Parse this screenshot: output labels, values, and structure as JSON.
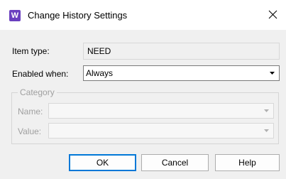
{
  "window": {
    "title": "Change History Settings",
    "app_icon_letter": "W",
    "app_icon_color": "#6a3fbf"
  },
  "form": {
    "item_type": {
      "label": "Item type:",
      "value": "NEED"
    },
    "enabled_when": {
      "label": "Enabled when:",
      "value": "Always"
    },
    "category": {
      "legend": "Category",
      "name": {
        "label": "Name:",
        "value": ""
      },
      "value": {
        "label": "Value:",
        "value": ""
      }
    }
  },
  "buttons": {
    "ok": "OK",
    "cancel": "Cancel",
    "help": "Help"
  }
}
